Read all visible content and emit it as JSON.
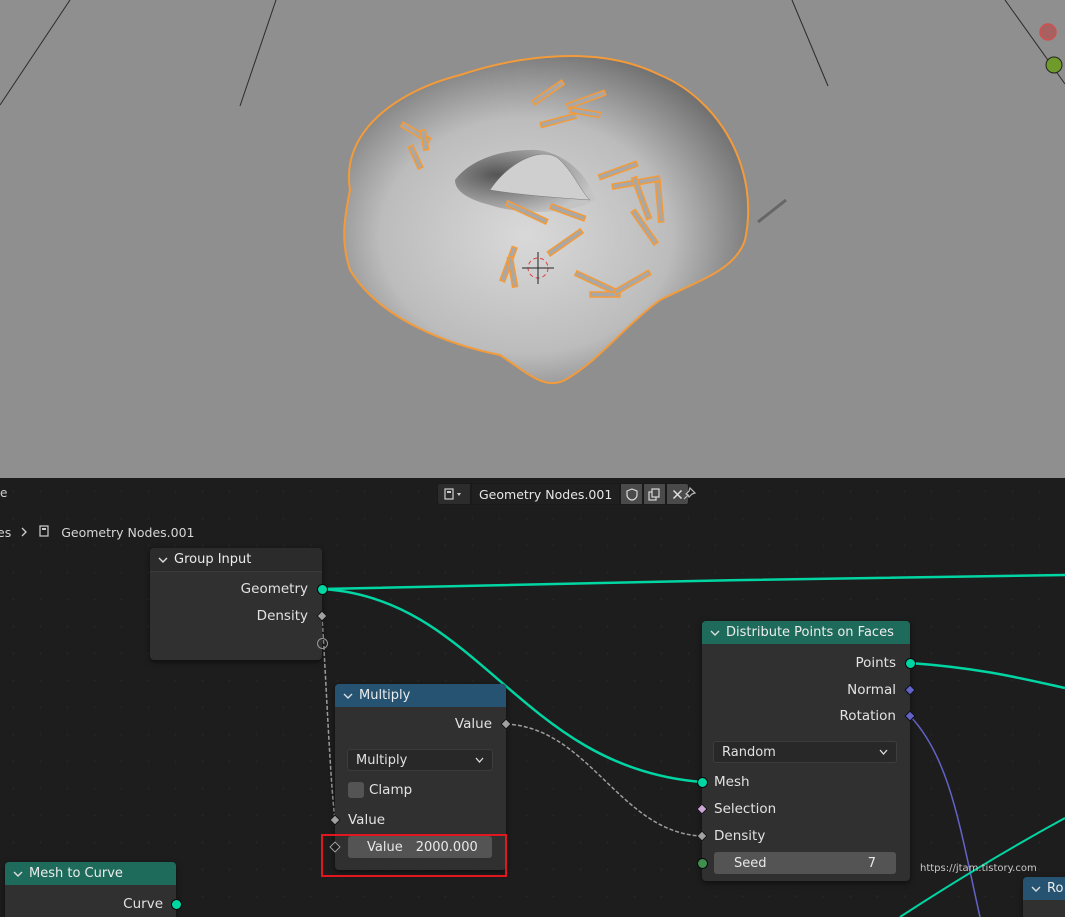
{
  "header": {
    "left_cut_label": "e",
    "node_tree_name": "Geometry Nodes.001",
    "icons": [
      "node-tree-icon",
      "shield-icon",
      "duplicate-icon",
      "close-icon",
      "pin-icon"
    ]
  },
  "breadcrumb": {
    "parent": "es",
    "current": "Geometry Nodes.001"
  },
  "nodes": {
    "group_input": {
      "title": "Group Input",
      "geometry": "Geometry",
      "density": "Density"
    },
    "multiply": {
      "title": "Multiply",
      "output_value": "Value",
      "operation": "Multiply",
      "clamp_label": "Clamp",
      "input_value_label": "Value",
      "field_label": "Value",
      "field_value": "2000.000"
    },
    "distribute": {
      "title": "Distribute Points on Faces",
      "points": "Points",
      "normal": "Normal",
      "rotation": "Rotation",
      "mode": "Random",
      "mesh": "Mesh",
      "selection": "Selection",
      "density": "Density",
      "seed_label": "Seed",
      "seed_value": "7"
    },
    "mesh_to_curve": {
      "title": "Mesh to Curve",
      "curve": "Curve"
    },
    "partial_right": {
      "title": "Ro"
    }
  },
  "watermark": "https://jtam.tistory.com",
  "colors": {
    "geometry_socket": "#00d6a3",
    "float_socket": "#a1a1a1",
    "vector_socket": "#6363c7",
    "highlight": "#e0171f",
    "selection_outline": "#f39b3a",
    "math_header": "#255371",
    "geometry_header": "#1e6b5b"
  }
}
